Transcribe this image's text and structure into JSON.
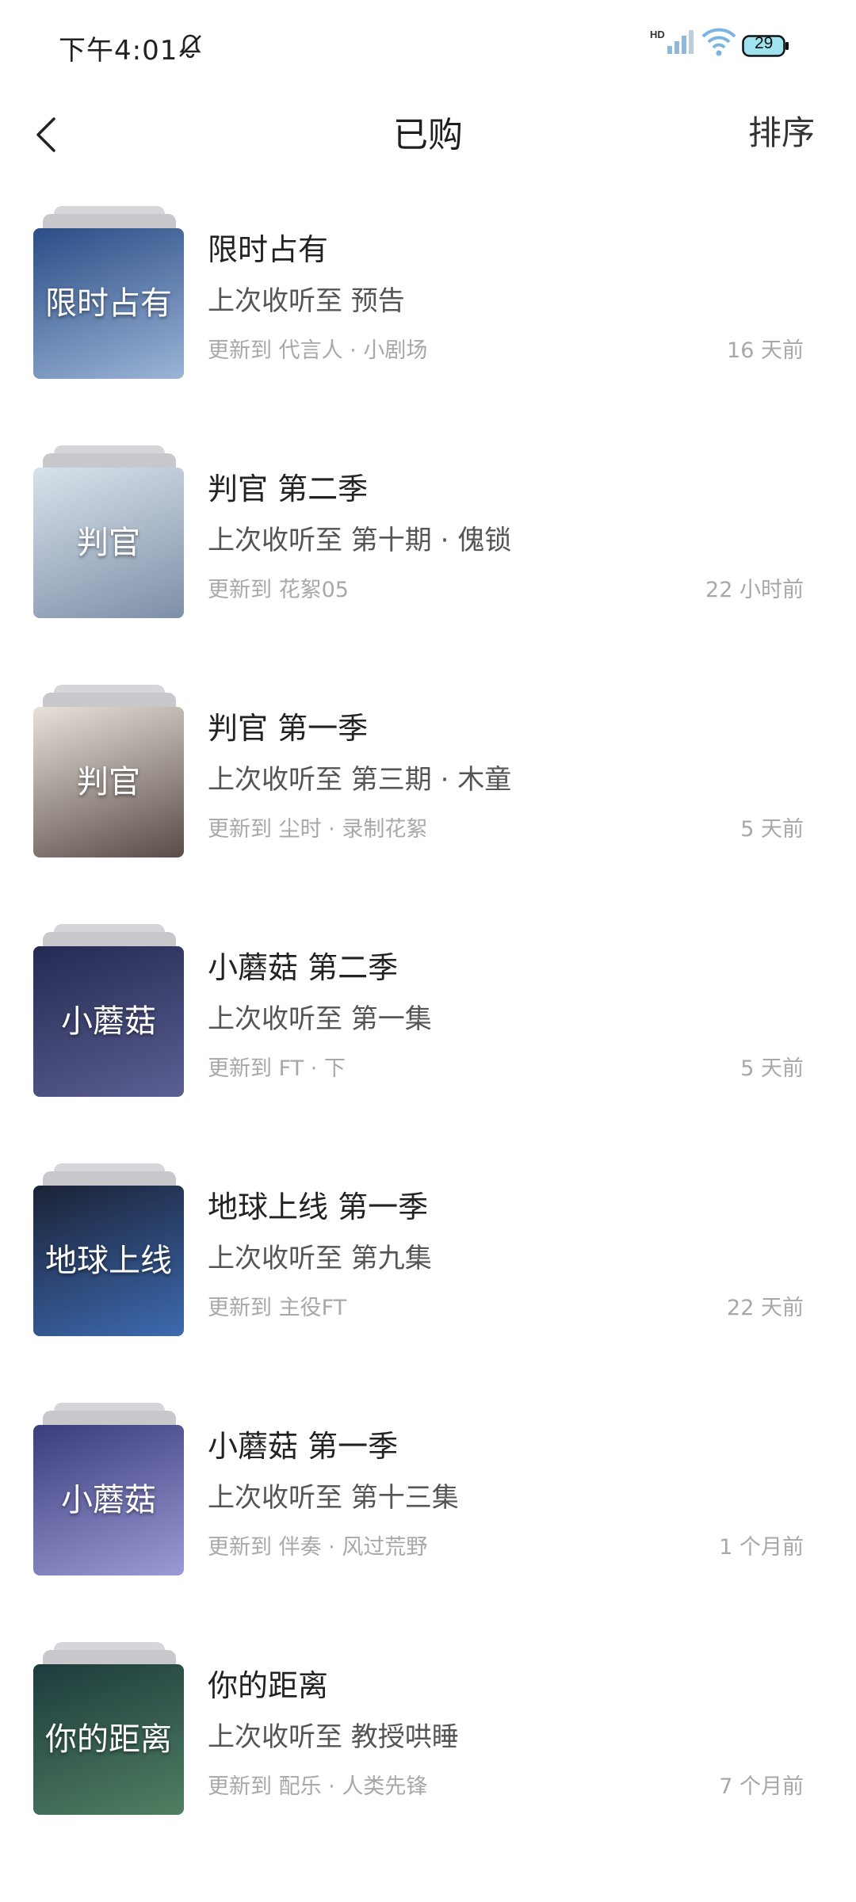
{
  "status_bar": {
    "time": "下午4:01",
    "battery": "29",
    "signal_label": "HD"
  },
  "header": {
    "title": "已购",
    "sort_label": "排序"
  },
  "items": [
    {
      "title": "限时占有",
      "progress": "上次收听至 预告",
      "update": "更新到 代言人 · 小剧场",
      "ago": "16 天前",
      "cover_text": "限时占有",
      "cover_colors": [
        "#2a4d86",
        "#9bb4d6"
      ]
    },
    {
      "title": "判官 第二季",
      "progress": "上次收听至 第十期 · 傀锁",
      "update": "更新到 花絮05",
      "ago": "22 小时前",
      "cover_text": "判官",
      "cover_colors": [
        "#d9e2ea",
        "#7d8fa8"
      ]
    },
    {
      "title": "判官 第一季",
      "progress": "上次收听至 第三期 · 木童",
      "update": "更新到 尘时 · 录制花絮",
      "ago": "5 天前",
      "cover_text": "判官",
      "cover_colors": [
        "#e7e2da",
        "#5a4b48"
      ]
    },
    {
      "title": "小蘑菇 第二季",
      "progress": "上次收听至 第一集",
      "update": "更新到 FT · 下",
      "ago": "5 天前",
      "cover_text": "小蘑菇",
      "cover_colors": [
        "#232a52",
        "#5c5f92"
      ]
    },
    {
      "title": "地球上线 第一季",
      "progress": "上次收听至 第九集",
      "update": "更新到 主役FT",
      "ago": "22 天前",
      "cover_text": "地球上线",
      "cover_colors": [
        "#1b2236",
        "#3d6ab0"
      ]
    },
    {
      "title": "小蘑菇 第一季",
      "progress": "上次收听至 第十三集",
      "update": "更新到 伴奏 · 风过荒野",
      "ago": "1 个月前",
      "cover_text": "小蘑菇",
      "cover_colors": [
        "#3a3d7a",
        "#9b9ad6"
      ]
    },
    {
      "title": "你的距离",
      "progress": "上次收听至 教授哄睡",
      "update": "更新到 配乐 · 人类先锋",
      "ago": "7 个月前",
      "cover_text": "你的距离",
      "cover_colors": [
        "#1d3b3c",
        "#4f7f62"
      ]
    }
  ]
}
